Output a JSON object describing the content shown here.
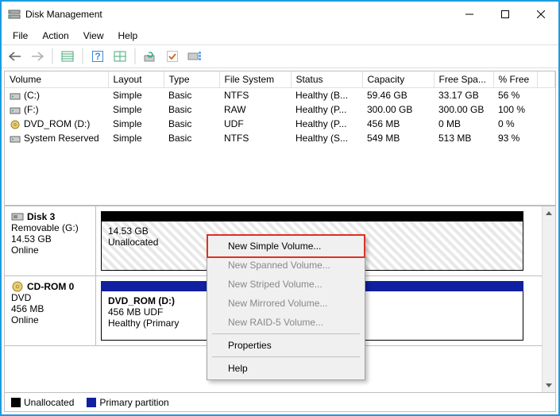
{
  "titlebar": {
    "title": "Disk Management"
  },
  "menubar": {
    "file": "File",
    "action": "Action",
    "view": "View",
    "help": "Help"
  },
  "table": {
    "headers": {
      "volume": "Volume",
      "layout": "Layout",
      "type": "Type",
      "fs": "File System",
      "status": "Status",
      "capacity": "Capacity",
      "free": "Free Spa...",
      "pct": "% Free"
    },
    "rows": [
      {
        "volume": "(C:)",
        "layout": "Simple",
        "type": "Basic",
        "fs": "NTFS",
        "status": "Healthy (B...",
        "capacity": "59.46 GB",
        "free": "33.17 GB",
        "pct": "56 %"
      },
      {
        "volume": "(F:)",
        "layout": "Simple",
        "type": "Basic",
        "fs": "RAW",
        "status": "Healthy (P...",
        "capacity": "300.00 GB",
        "free": "300.00 GB",
        "pct": "100 %"
      },
      {
        "volume": "DVD_ROM (D:)",
        "layout": "Simple",
        "type": "Basic",
        "fs": "UDF",
        "status": "Healthy (P...",
        "capacity": "456 MB",
        "free": "0 MB",
        "pct": "0 %"
      },
      {
        "volume": "System Reserved",
        "layout": "Simple",
        "type": "Basic",
        "fs": "NTFS",
        "status": "Healthy (S...",
        "capacity": "549 MB",
        "free": "513 MB",
        "pct": "93 %"
      }
    ]
  },
  "disks": {
    "disk3": {
      "name": "Disk 3",
      "sub1": "Removable (G:)",
      "sub2": "14.53 GB",
      "sub3": "Online",
      "part_size": "14.53 GB",
      "part_state": "Unallocated"
    },
    "cdrom": {
      "name": "CD-ROM 0",
      "sub1": "DVD",
      "sub2": "456 MB",
      "sub3": "Online",
      "part_name": "DVD_ROM  (D:)",
      "part_line2": "456 MB UDF",
      "part_line3": "Healthy (Primary"
    }
  },
  "legend": {
    "unalloc": "Unallocated",
    "primary": "Primary partition"
  },
  "context": {
    "new_simple": "New Simple Volume...",
    "new_spanned": "New Spanned Volume...",
    "new_striped": "New Striped Volume...",
    "new_mirrored": "New Mirrored Volume...",
    "new_raid5": "New RAID-5 Volume...",
    "properties": "Properties",
    "help": "Help"
  }
}
